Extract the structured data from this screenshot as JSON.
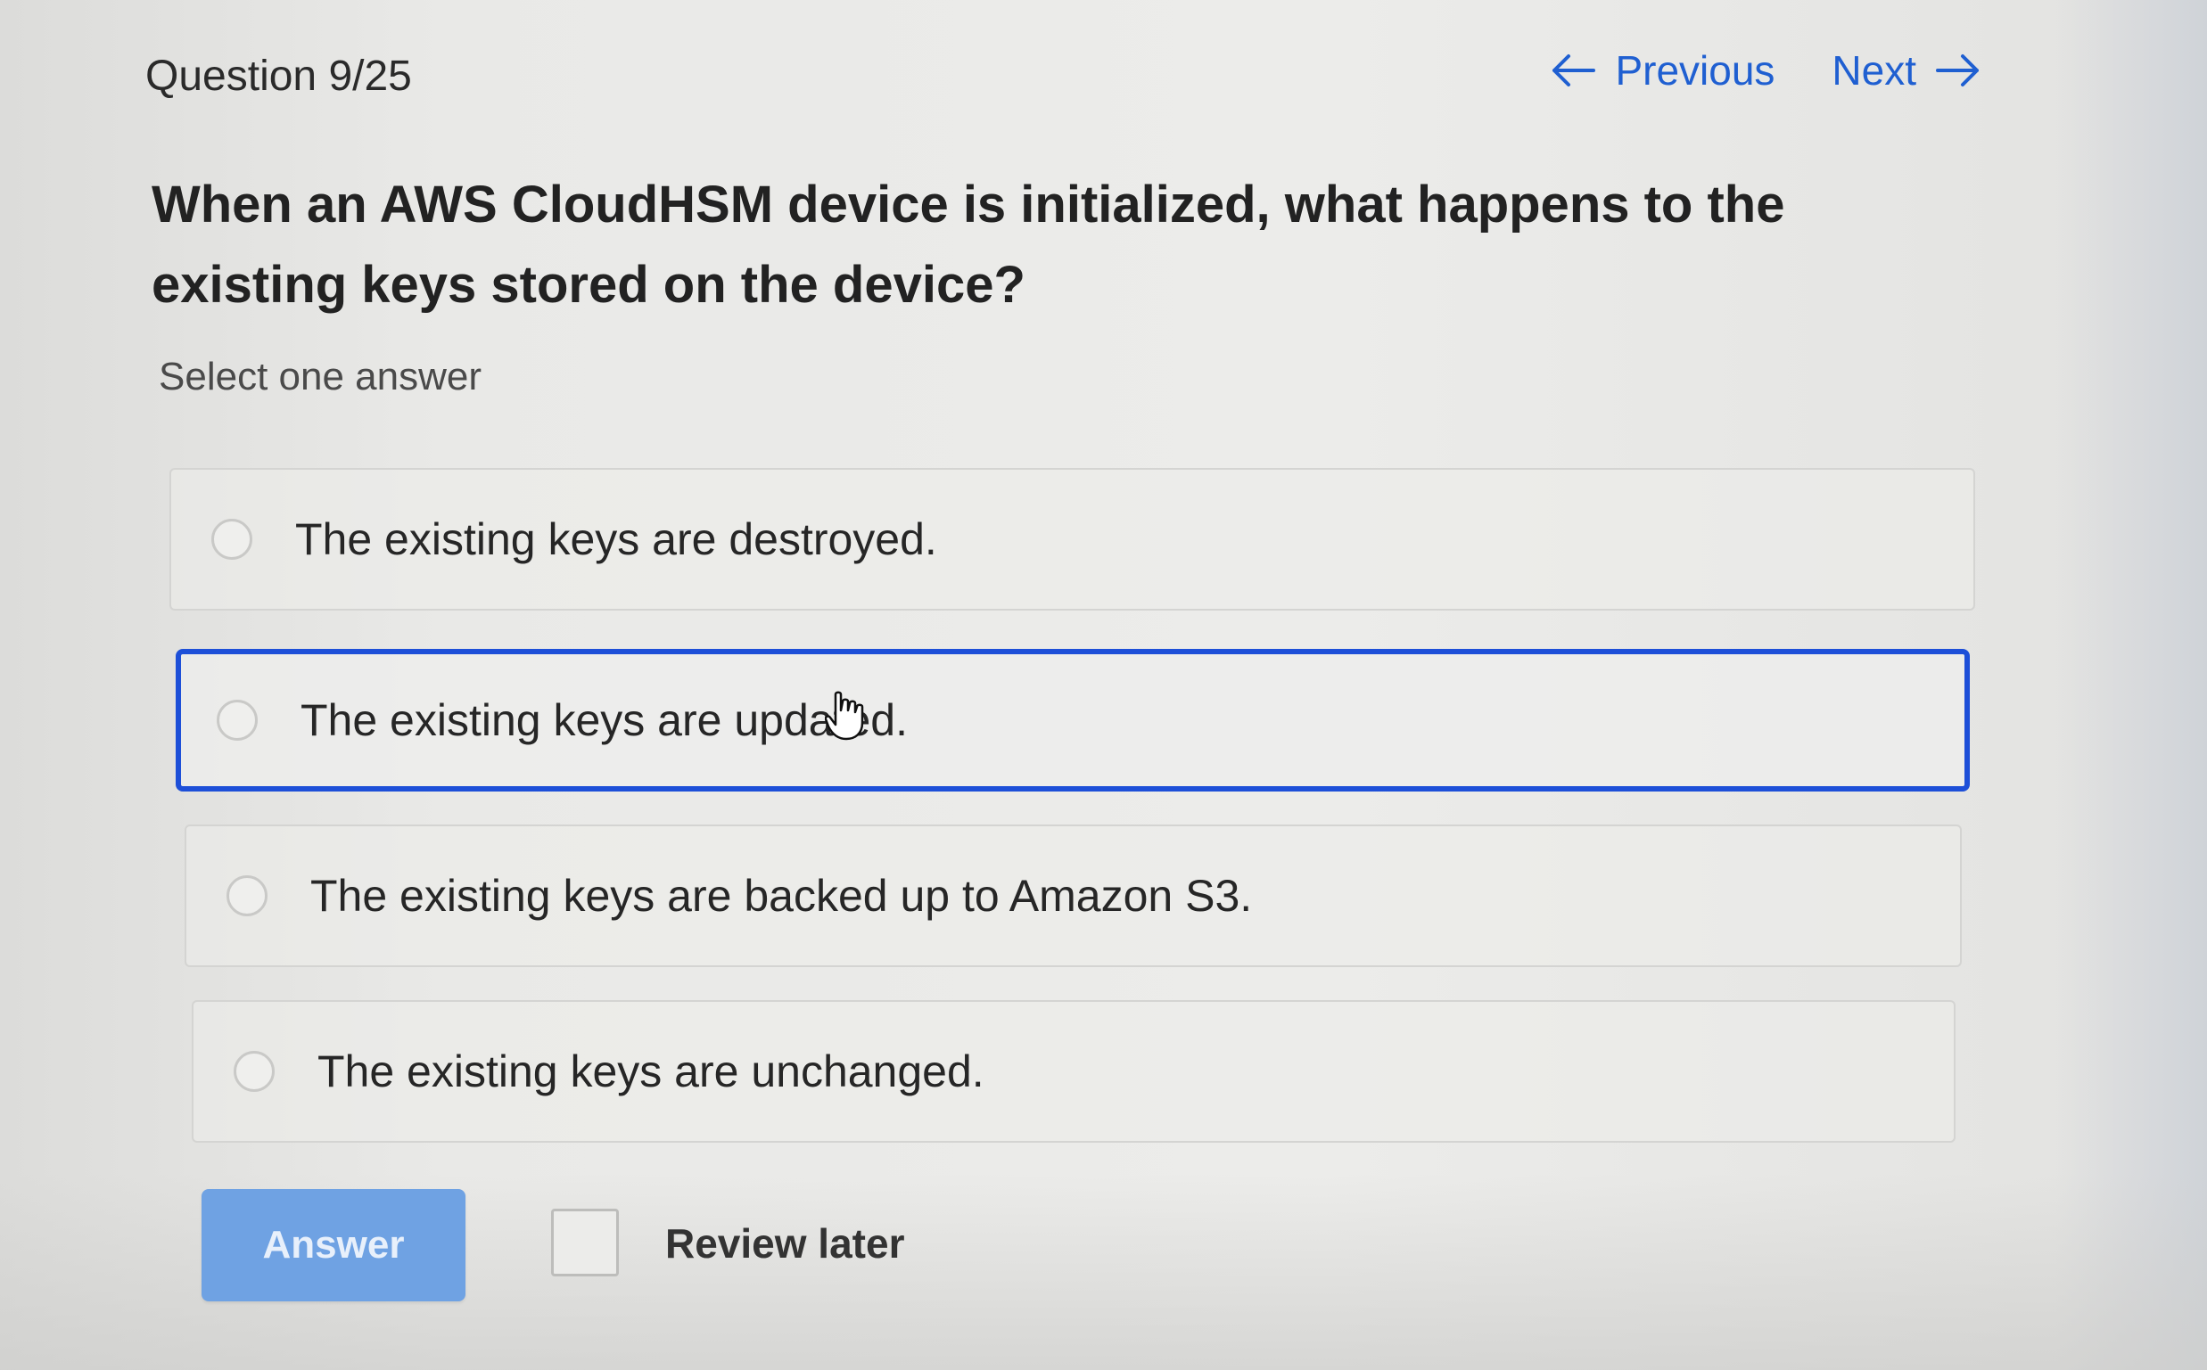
{
  "header": {
    "question_counter": "Question 9/25",
    "previous_label": "Previous",
    "next_label": "Next"
  },
  "question": {
    "text": "When an AWS CloudHSM device is initialized, what happens to the existing keys stored on the device?",
    "instruction": "Select one answer"
  },
  "options": [
    {
      "label": "The existing keys are destroyed."
    },
    {
      "label": "The existing keys are updated."
    },
    {
      "label": "The existing keys are backed up to Amazon S3."
    },
    {
      "label": "The existing keys are unchanged."
    }
  ],
  "footer": {
    "answer_label": "Answer",
    "review_later_label": "Review later"
  },
  "colors": {
    "accent": "#1f5fd1",
    "selected_border": "#1d4fd8",
    "answer_button": "#6fa2e3"
  }
}
